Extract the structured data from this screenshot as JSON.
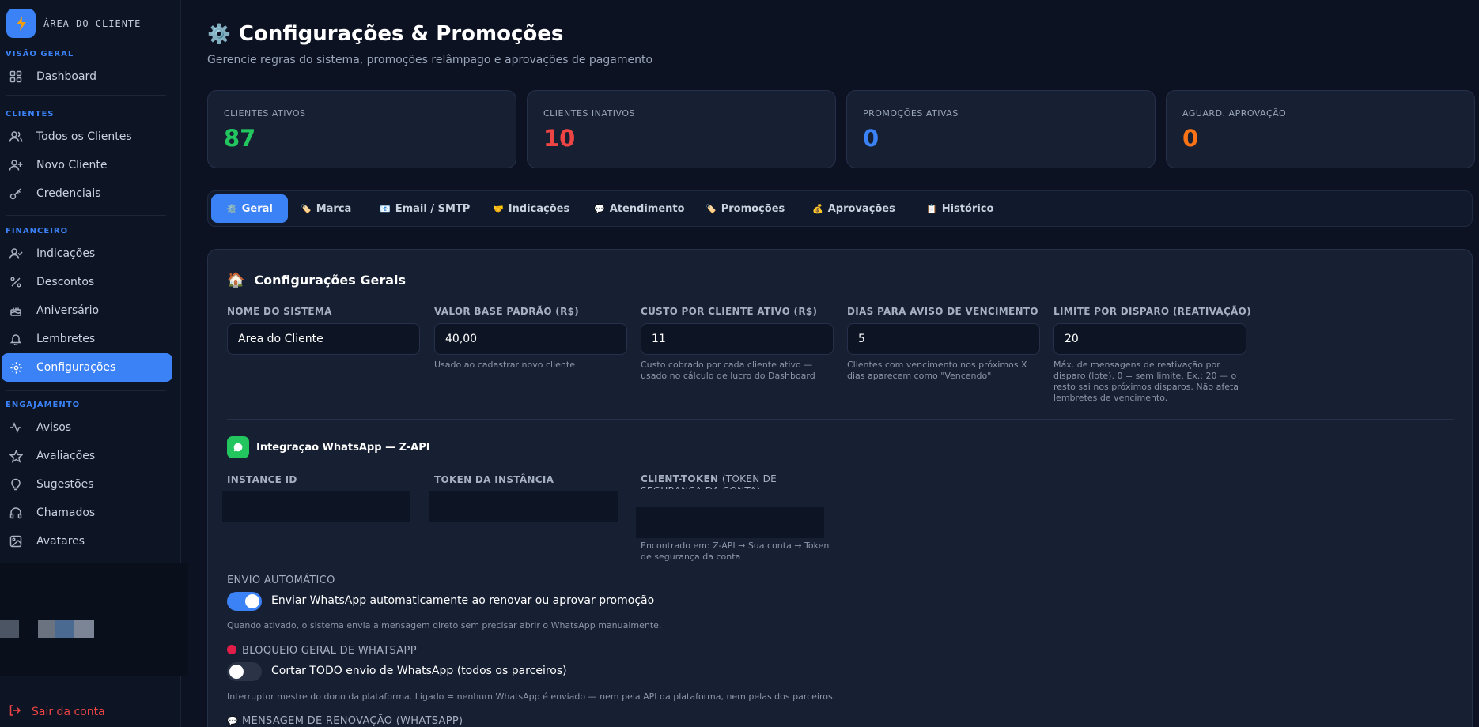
{
  "sidebar": {
    "brand": "ÁREA DO CLIENTE",
    "sections": [
      {
        "title": "VISÃO GERAL",
        "items": [
          {
            "label": "Dashboard",
            "icon": "grid-icon"
          }
        ]
      },
      {
        "title": "CLIENTES",
        "items": [
          {
            "label": "Todos os Clientes",
            "icon": "users-icon"
          },
          {
            "label": "Novo Cliente",
            "icon": "user-plus-icon"
          },
          {
            "label": "Credenciais",
            "icon": "key-icon"
          }
        ]
      },
      {
        "title": "FINANCEIRO",
        "items": [
          {
            "label": "Indicações",
            "icon": "user-check-icon"
          },
          {
            "label": "Descontos",
            "icon": "percent-icon"
          },
          {
            "label": "Aniversário",
            "icon": "cake-icon"
          },
          {
            "label": "Lembretes",
            "icon": "bell-icon"
          },
          {
            "label": "Configurações",
            "icon": "gear-icon"
          }
        ]
      },
      {
        "title": "ENGAJAMENTO",
        "items": [
          {
            "label": "Avisos",
            "icon": "activity-icon"
          },
          {
            "label": "Avaliações",
            "icon": "star-icon"
          },
          {
            "label": "Sugestões",
            "icon": "lightbulb-icon"
          },
          {
            "label": "Chamados",
            "icon": "headphones-icon"
          },
          {
            "label": "Avatares",
            "icon": "image-icon"
          }
        ]
      }
    ],
    "active": "Configurações",
    "logout": "Sair da conta"
  },
  "header": {
    "emoji": "⚙️",
    "title": "Configurações & Promoções",
    "subtitle": "Gerencie regras do sistema, promoções relâmpago e aprovações de pagamento"
  },
  "stats": [
    {
      "label": "CLIENTES ATIVOS",
      "value": "87",
      "color": "#22c55e"
    },
    {
      "label": "CLIENTES INATIVOS",
      "value": "10",
      "color": "#ef4444"
    },
    {
      "label": "PROMOÇÕES ATIVAS",
      "value": "0",
      "color": "#3b82f6"
    },
    {
      "label": "AGUARD. APROVAÇÃO",
      "value": "0",
      "color": "#f97316"
    }
  ],
  "tabs": [
    {
      "emoji": "⚙️",
      "label": "Geral"
    },
    {
      "emoji": "🏷️",
      "label": "Marca"
    },
    {
      "emoji": "📧",
      "label": "Email / SMTP"
    },
    {
      "emoji": "🤝",
      "label": "Indicações"
    },
    {
      "emoji": "💬",
      "label": "Atendimento"
    },
    {
      "emoji": "🏷️",
      "label": "Promoções"
    },
    {
      "emoji": "💰",
      "label": "Aprovações"
    },
    {
      "emoji": "📋",
      "label": "Histórico"
    }
  ],
  "active_tab": "Geral",
  "general": {
    "emoji": "🏠",
    "title": "Configurações Gerais",
    "fields": [
      {
        "label": "NOME DO SISTEMA",
        "value": "Área do Cliente",
        "help": ""
      },
      {
        "label": "VALOR BASE PADRÃO (R$)",
        "value": "40,00",
        "help": "Usado ao cadastrar novo cliente"
      },
      {
        "label": "CUSTO POR CLIENTE ATIVO (R$)",
        "value": "11",
        "help": "Custo cobrado por cada cliente ativo — usado no cálculo de lucro do Dashboard"
      },
      {
        "label": "DIAS PARA AVISO DE VENCIMENTO",
        "value": "5",
        "help": "Clientes com vencimento nos próximos X dias aparecem como \"Vencendo\""
      },
      {
        "label": "LIMITE POR DISPARO (REATIVAÇÃO)",
        "value": "20",
        "help": "Máx. de mensagens de reativação por disparo (lote). 0 = sem limite. Ex.: 20 — o resto sai nos próximos disparos. Não afeta lembretes de vencimento."
      }
    ]
  },
  "whatsapp": {
    "title": "Integração WhatsApp — Z-API",
    "instance_label": "INSTANCE ID",
    "token_label": "TOKEN DA INSTÂNCIA",
    "client_token_label": "CLIENT-TOKEN",
    "client_token_suffix": "(TOKEN DE SEGURANÇA DA CONTA)",
    "client_token_help": "Encontrado em: Z-API → Sua conta → Token de segurança da conta",
    "auto_label": "ENVIO AUTOMÁTICO",
    "auto_toggle_text": "Enviar WhatsApp automaticamente ao renovar ou aprovar promoção",
    "auto_enabled": true,
    "auto_help": "Quando ativado, o sistema envia a mensagem direto sem precisar abrir o WhatsApp manualmente.",
    "block_label": "BLOQUEIO GERAL DE WHATSAPP",
    "block_toggle_text": "Cortar TODO envio de WhatsApp (todos os parceiros)",
    "block_enabled": false,
    "block_help": "Interruptor mestre do dono da plataforma. Ligado = nenhum WhatsApp é enviado — nem pela API da plataforma, nem pelas dos parceiros.",
    "renewal_emoji": "💬",
    "renewal_label": "MENSAGEM DE RENOVAÇÃO (WHATSAPP)"
  },
  "colors": {
    "accent": "#3b82f6",
    "whatsapp": "#22c55e",
    "danger": "#ef4444"
  }
}
